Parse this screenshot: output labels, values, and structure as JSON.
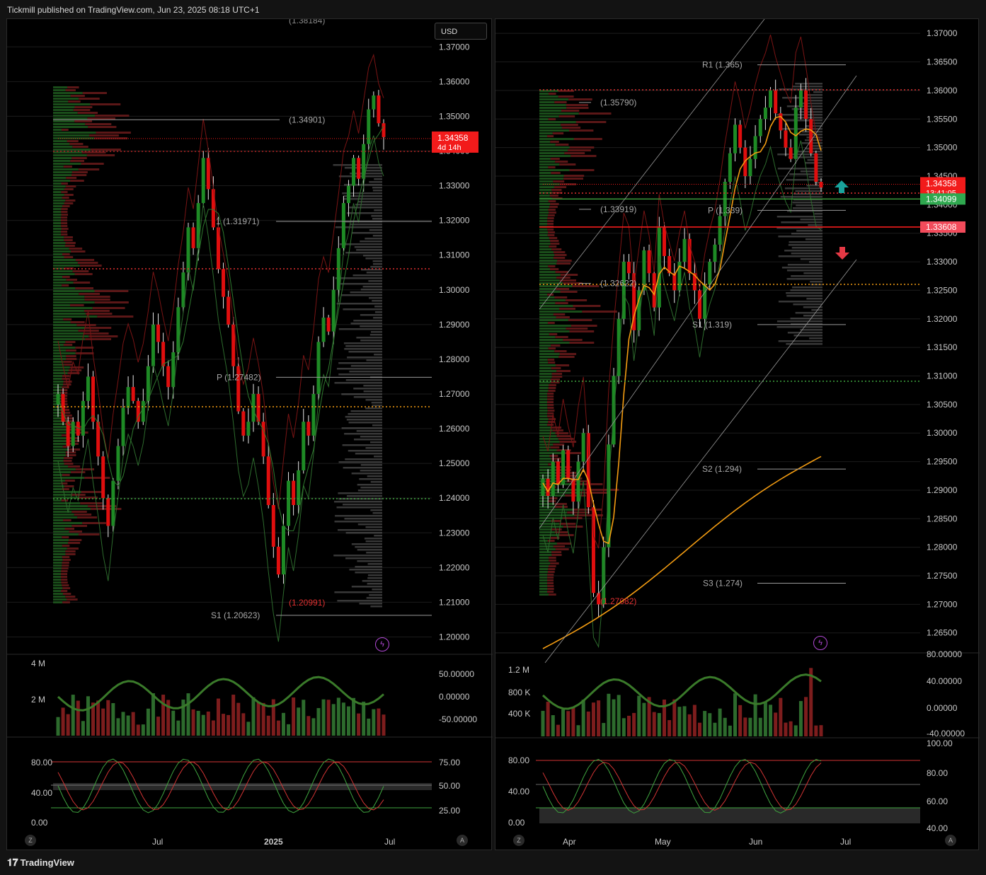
{
  "header": {
    "published": "Tickmill published on TradingView.com, Jun 23, 2025 08:18 UTC+1"
  },
  "footer": {
    "brand": "TradingView",
    "logo_icon": "tradingview-logo-icon"
  },
  "colors": {
    "bg": "#000000",
    "bull": "#1e8a25",
    "bear": "#e00e0e",
    "grid": "#1c1c1c",
    "ma": "#f39c12",
    "price_tag": "#f21b1b",
    "green_tag": "#2fa84f",
    "pivot": "#cccccc"
  },
  "chart_data": [
    {
      "type": "candlestick",
      "name": "left",
      "currency_button": "USD",
      "y_ticks": [
        "1.37000",
        "1.36000",
        "1.35000",
        "1.34000",
        "1.33000",
        "1.32000",
        "1.31000",
        "1.30000",
        "1.29000",
        "1.28000",
        "1.27000",
        "1.26000",
        "1.25000",
        "1.24000",
        "1.23000",
        "1.22000",
        "1.21000",
        "1.20000"
      ],
      "ylim": [
        1.195,
        1.378
      ],
      "x_ticks": [
        "Jul",
        "2025",
        "Jul"
      ],
      "last_price": "1.34358",
      "countdown": "4d 14h",
      "pivot_levels": [
        {
          "label": "(1.34901)",
          "value": 1.34901
        },
        {
          "label": "1 (1.31971)",
          "value": 1.31971
        },
        {
          "label": "P (1.27482)",
          "value": 1.27482
        },
        {
          "label": "S1 (1.20623)",
          "value": 1.20623
        }
      ],
      "top_level_label": "(1.38184)",
      "low_label": "(1.20991)",
      "close_path": [
        1.27,
        1.262,
        1.255,
        1.262,
        1.258,
        1.268,
        1.275,
        1.262,
        1.252,
        1.24,
        1.232,
        1.245,
        1.255,
        1.266,
        1.272,
        1.268,
        1.262,
        1.268,
        1.278,
        1.29,
        1.285,
        1.278,
        1.272,
        1.282,
        1.295,
        1.305,
        1.318,
        1.312,
        1.325,
        1.338,
        1.329,
        1.318,
        1.306,
        1.298,
        1.29,
        1.278,
        1.265,
        1.258,
        1.262,
        1.27,
        1.262,
        1.252,
        1.238,
        1.226,
        1.218,
        1.232,
        1.245,
        1.238,
        1.248,
        1.262,
        1.258,
        1.27,
        1.285,
        1.292,
        1.288,
        1.3,
        1.312,
        1.325,
        1.33,
        1.338,
        1.332,
        1.342,
        1.352,
        1.356,
        1.348,
        1.344
      ],
      "volume_ticks": [
        "4 M",
        "2 M"
      ],
      "rsi_ticks": [
        "50.00000",
        "0.00000",
        "-50.00000"
      ],
      "stoch_left_ticks": [
        "80.00",
        "40.00",
        "0.00"
      ],
      "stoch_right_ticks": [
        "75.00",
        "50.00",
        "25.00"
      ],
      "z_button": "Z",
      "a_button": "A"
    },
    {
      "type": "candlestick",
      "name": "right",
      "y_ticks": [
        "1.37000",
        "1.36500",
        "1.36000",
        "1.35500",
        "1.35000",
        "1.34500",
        "1.34000",
        "1.33500",
        "1.33000",
        "1.32500",
        "1.32000",
        "1.31500",
        "1.31000",
        "1.30500",
        "1.30000",
        "1.29500",
        "1.29000",
        "1.28500",
        "1.28000",
        "1.27500",
        "1.27000",
        "1.26500"
      ],
      "ylim": [
        1.2615,
        1.3725
      ],
      "x_ticks": [
        "Apr",
        "May",
        "Jun",
        "Jul"
      ],
      "last_price": "1.34358",
      "countdown": "13:41:05",
      "green_level": "1.34099",
      "red_level": "1.33608",
      "pivot_levels": [
        {
          "label": "R1 (1.365)",
          "value": 1.3645
        },
        {
          "label": "(1.35790)",
          "value": 1.3579
        },
        {
          "label": "(1.33919)",
          "value": 1.33919
        },
        {
          "label": "P (1.339)",
          "value": 1.339
        },
        {
          "label": "(1.32622)",
          "value": 1.32622
        },
        {
          "label": "S1 (1.319)",
          "value": 1.319
        },
        {
          "label": "S2 (1.294)",
          "value": 1.2937
        },
        {
          "label": "S3 (1.274)",
          "value": 1.2737
        }
      ],
      "low_label": "(1.27082)",
      "close_path": [
        1.292,
        1.289,
        1.295,
        1.291,
        1.297,
        1.292,
        1.288,
        1.295,
        1.3,
        1.287,
        1.272,
        1.27,
        1.28,
        1.298,
        1.31,
        1.32,
        1.33,
        1.328,
        1.318,
        1.325,
        1.332,
        1.328,
        1.322,
        1.336,
        1.331,
        1.328,
        1.325,
        1.33,
        1.334,
        1.328,
        1.325,
        1.32,
        1.326,
        1.33,
        1.333,
        1.338,
        1.344,
        1.349,
        1.354,
        1.35,
        1.345,
        1.348,
        1.352,
        1.355,
        1.357,
        1.36,
        1.356,
        1.353,
        1.35,
        1.348,
        1.357,
        1.36,
        1.355,
        1.349,
        1.344,
        1.343
      ],
      "volume_ticks": [
        "1.2 M",
        "800 K",
        "400 K"
      ],
      "rsi_ticks": [
        "80.00000",
        "40.00000",
        "0.00000",
        "-40.00000"
      ],
      "stoch_left_ticks": [
        "80.00",
        "40.00",
        "0.00"
      ],
      "stoch_right_ticks": [
        "100.00",
        "80.00",
        "60.00",
        "40.00"
      ],
      "z_button": "Z",
      "a_button": "A"
    }
  ]
}
